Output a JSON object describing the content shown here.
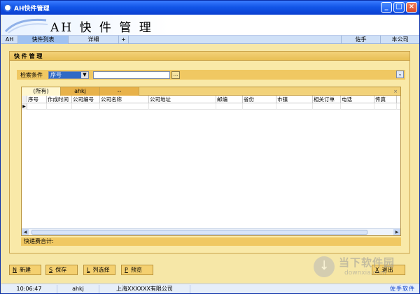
{
  "window": {
    "title": "AH快件管理"
  },
  "banner": {
    "brand": "AH 快 件 管 理"
  },
  "nav": {
    "left_tabs": [
      "AH",
      "快件列表",
      "详细",
      "+"
    ],
    "right_tabs": [
      "佐手",
      "本公司"
    ]
  },
  "panel": {
    "title": "快 件 管 理"
  },
  "search": {
    "label": "检索条件",
    "field": "序号",
    "value": "",
    "ellipsis": "..."
  },
  "grid": {
    "tabs": [
      "(所有)",
      "ahkj",
      "--"
    ],
    "columns": [
      "序号",
      "作成时间",
      "公司编号",
      "公司名称",
      "公司地址",
      "邮编",
      "省份",
      "市镇",
      "相关订单",
      "电话",
      "传真"
    ],
    "rows": []
  },
  "footer": {
    "label": "快递费合计:"
  },
  "buttons": [
    {
      "key": "N",
      "label": "新建"
    },
    {
      "key": "S",
      "label": "保存"
    },
    {
      "key": "L",
      "label": "列选择"
    },
    {
      "key": "P",
      "label": "预览"
    },
    {
      "key": "X",
      "label": "退出"
    }
  ],
  "watermark": {
    "cn": "当下软件园",
    "en": "downxia.com"
  },
  "status": {
    "time": "10:06:47",
    "user": "ahkj",
    "company": "上海XXXXXX有限公司",
    "brand": "佐手软件"
  }
}
